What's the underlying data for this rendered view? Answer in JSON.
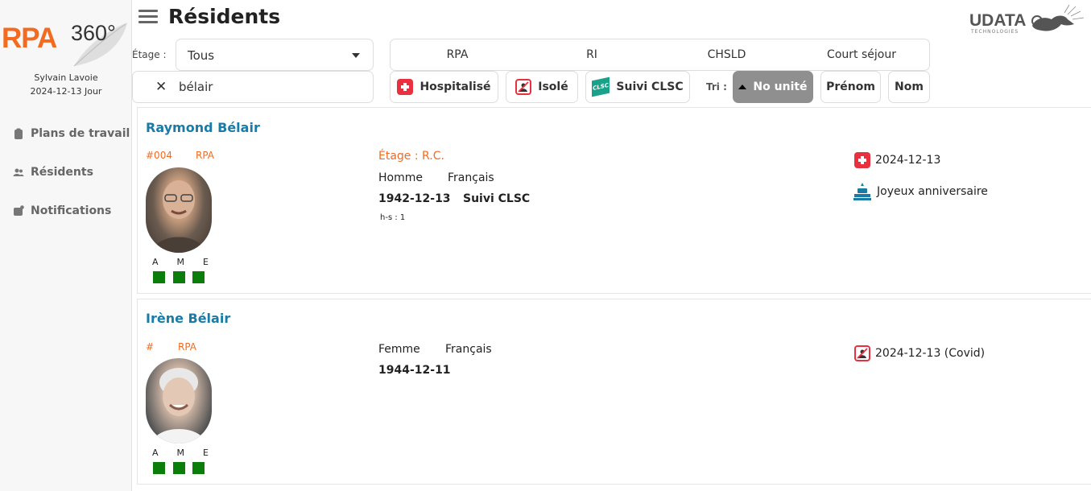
{
  "app": {
    "logo_text": "RPA",
    "logo_suffix": "360°",
    "brand": "UDATA",
    "brand_sub": "TECHNOLOGIES"
  },
  "user": {
    "name": "Sylvain Lavoie",
    "shift": "2024-12-13 Jour"
  },
  "sidebar": {
    "items": [
      {
        "label": "Plans de travail",
        "icon": "clipboard-icon"
      },
      {
        "label": "Résidents",
        "icon": "users-icon"
      },
      {
        "label": "Notifications",
        "icon": "notification-icon"
      }
    ]
  },
  "header": {
    "title": "Résidents"
  },
  "filters": {
    "floor_label": "Étage :",
    "floor_value": "Tous",
    "search_value": "bélair",
    "types": [
      "RPA",
      "RI",
      "CHSLD",
      "Court séjour"
    ],
    "status": [
      "Hospitalisé",
      "Isolé",
      "Suivi CLSC"
    ],
    "sort_label": "Tri :",
    "sort_options": [
      "No unité",
      "Prénom",
      "Nom"
    ],
    "sort_active": "No unité"
  },
  "colors": {
    "accent": "#f26b21",
    "name_blue": "#1a7ba6",
    "status_green": "#0b7d0b",
    "alert_red": "#e8303e",
    "sort_active_bg": "#8f8f8f"
  },
  "residents": [
    {
      "name": "Raymond Bélair",
      "number": "#004",
      "type": "RPA",
      "floor": "Étage : R.C.",
      "gender": "Homme",
      "language": "Français",
      "birthdate": "1942-12-13",
      "follow_up": "Suivi CLSC",
      "extra": "h-s : 1",
      "ame": [
        "A",
        "M",
        "E"
      ],
      "alerts": [
        {
          "icon": "hospital-cross-icon",
          "text": "2024-12-13"
        },
        {
          "icon": "birthday-cake-icon",
          "text": "Joyeux anniversaire"
        }
      ]
    },
    {
      "name": "Irène Bélair",
      "number": "#",
      "type": "RPA",
      "gender": "Femme",
      "language": "Français",
      "birthdate": "1944-12-11",
      "ame": [
        "A",
        "M",
        "E"
      ],
      "alerts": [
        {
          "icon": "isolation-icon",
          "text": "2024-12-13 (Covid)"
        }
      ]
    }
  ]
}
